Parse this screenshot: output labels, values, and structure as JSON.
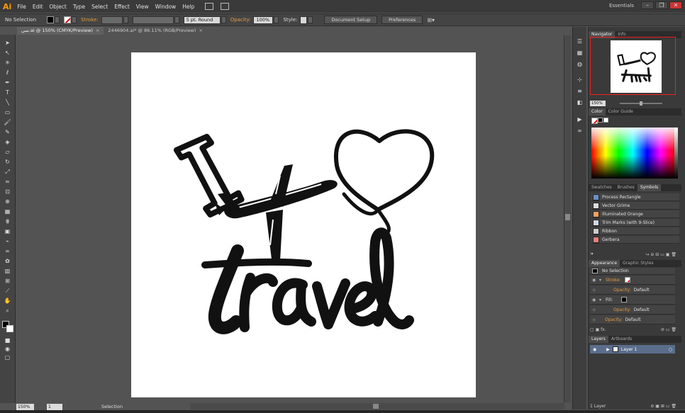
{
  "app": {
    "logo": "Ai",
    "workspace": "Essentials"
  },
  "menu": [
    "File",
    "Edit",
    "Object",
    "Type",
    "Select",
    "Effect",
    "View",
    "Window",
    "Help"
  ],
  "control_bar": {
    "selection": "No Selection",
    "stroke_label": "Stroke:",
    "brush": "5 pt. Round",
    "opacity_label": "Opacity:",
    "opacity_value": "100%",
    "style_label": "Style:",
    "document_setup": "Document Setup",
    "preferences": "Preferences"
  },
  "tabs": [
    {
      "label": "سي.ai @ 150% (CMYK/Preview)",
      "close": "×"
    },
    {
      "label": "2446904.ai* @ 86.11% (RGB/Preview)",
      "close": "×"
    }
  ],
  "artwork": {
    "text": "travel",
    "letter": "I"
  },
  "status": {
    "zoom": "150%",
    "page": "1",
    "tool": "Selection"
  },
  "navigator": {
    "tabs": [
      "Navigator",
      "Info"
    ],
    "zoom": "150%"
  },
  "color": {
    "tabs": [
      "Color",
      "Color Guide"
    ]
  },
  "symbols": {
    "tabs": [
      "Swatches",
      "Brushes",
      "Symbols"
    ],
    "items": [
      "Process Rectangle",
      "Vector Grime",
      "Illuminated Orange",
      "Trim Marks (with 9-Slice)",
      "Ribbon",
      "Gerbera"
    ]
  },
  "appearance": {
    "tabs": [
      "Appearance",
      "Graphic Styles"
    ],
    "title": "No Selection",
    "stroke": "Stroke:",
    "fill": "Fill:",
    "opacity": "Opacity:",
    "default": "Default"
  },
  "layers": {
    "tabs": [
      "Layers",
      "Artboards"
    ],
    "layer_name": "Layer 1",
    "count": "1 Layer"
  },
  "colors": {
    "accent": "#ff9a00",
    "label_orange": "#e69b3f",
    "panel_bg": "#3a3a3a",
    "canvas_bg": "#535353",
    "layer_sel": "#5a6e8c"
  }
}
